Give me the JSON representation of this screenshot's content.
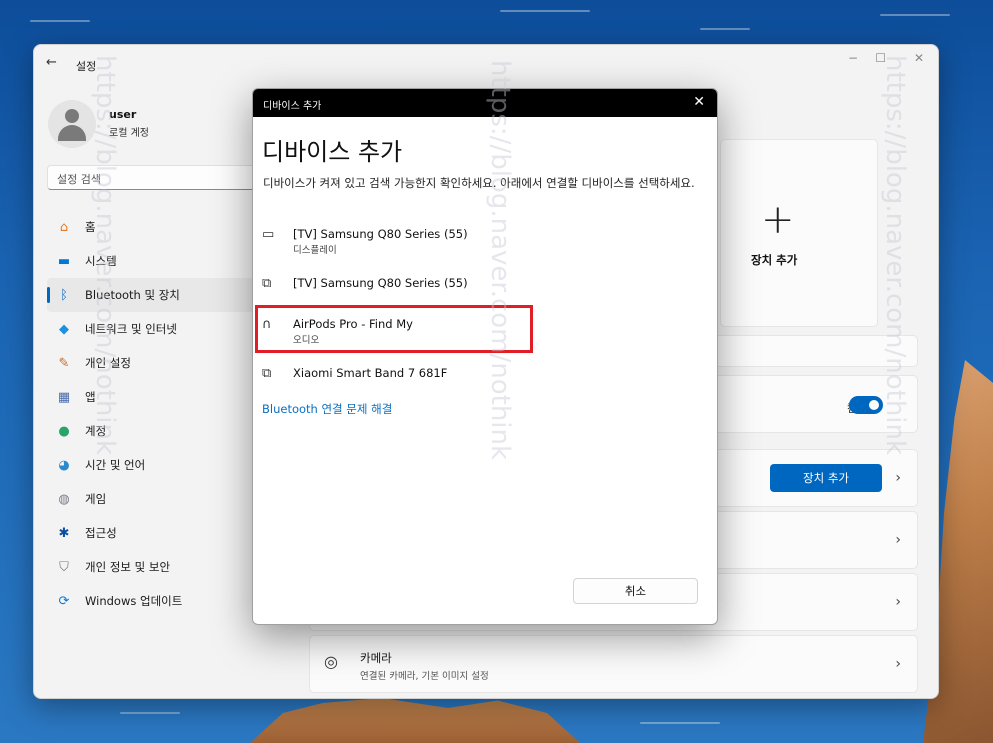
{
  "window": {
    "title": "설정",
    "back_glyph": "←",
    "minimize_glyph": "−",
    "maximize_glyph": "☐",
    "close_glyph": "✕"
  },
  "user": {
    "name": "user",
    "account_type": "로컬 계정"
  },
  "search": {
    "placeholder": "설정 검색"
  },
  "sidebar": {
    "items": [
      {
        "label": "홈",
        "icon": "home-icon",
        "glyph": "⌂",
        "color": "#e07a2a"
      },
      {
        "label": "시스템",
        "icon": "system-icon",
        "glyph": "▬",
        "color": "#0078d4"
      },
      {
        "label": "Bluetooth 및 장치",
        "icon": "bluetooth-icon",
        "glyph": "ᛒ",
        "color": "#0067c0",
        "active": true
      },
      {
        "label": "네트워크 및 인터넷",
        "icon": "network-icon",
        "glyph": "◆",
        "color": "#1e90e0"
      },
      {
        "label": "개인 설정",
        "icon": "brush-icon",
        "glyph": "✎",
        "color": "#c46b2b"
      },
      {
        "label": "앱",
        "icon": "apps-icon",
        "glyph": "▦",
        "color": "#4a6aa8"
      },
      {
        "label": "계정",
        "icon": "account-icon",
        "glyph": "●",
        "color": "#2aa36b"
      },
      {
        "label": "시간 및 언어",
        "icon": "globe-clock-icon",
        "glyph": "◕",
        "color": "#2a8ad0"
      },
      {
        "label": "게임",
        "icon": "gamepad-icon",
        "glyph": "◍",
        "color": "#7a7a8a"
      },
      {
        "label": "접근성",
        "icon": "accessibility-icon",
        "glyph": "✱",
        "color": "#0a4fa0"
      },
      {
        "label": "개인 정보 및 보안",
        "icon": "shield-icon",
        "glyph": "⛉",
        "color": "#7a7a7a"
      },
      {
        "label": "Windows 업데이트",
        "icon": "update-icon",
        "glyph": "⟳",
        "color": "#0a78d4"
      }
    ]
  },
  "content": {
    "add_tile_label": "장치 추가",
    "toggle_label": "켬",
    "add_button": "장치 추가",
    "camera_title": "카메라",
    "camera_sub": "연결된 카메라, 기본 이미지 설정"
  },
  "dialog": {
    "bar_title": "디바이스 추가",
    "heading": "디바이스 추가",
    "description": "디바이스가 켜져 있고 검색 가능한지 확인하세요. 아래에서 연결할 디바이스를 선택하세요.",
    "devices": [
      {
        "name": "[TV] Samsung Q80 Series (55)",
        "type": "디스플레이",
        "icon": "monitor-icon",
        "glyph": "▭"
      },
      {
        "name": "[TV] Samsung Q80 Series (55)",
        "type": "",
        "icon": "device-icon",
        "glyph": "⧉"
      },
      {
        "name": "AirPods Pro - Find My",
        "type": "오디오",
        "icon": "headphones-icon",
        "glyph": "∩"
      },
      {
        "name": "Xiaomi Smart Band 7 681F",
        "type": "",
        "icon": "device-icon",
        "glyph": "⧉"
      }
    ],
    "troubleshoot_link": "Bluetooth 연결 문제 해결",
    "cancel_button": "취소",
    "close_glyph": "✕"
  },
  "watermark": {
    "text": "https://blog.naver.com/nothink"
  }
}
